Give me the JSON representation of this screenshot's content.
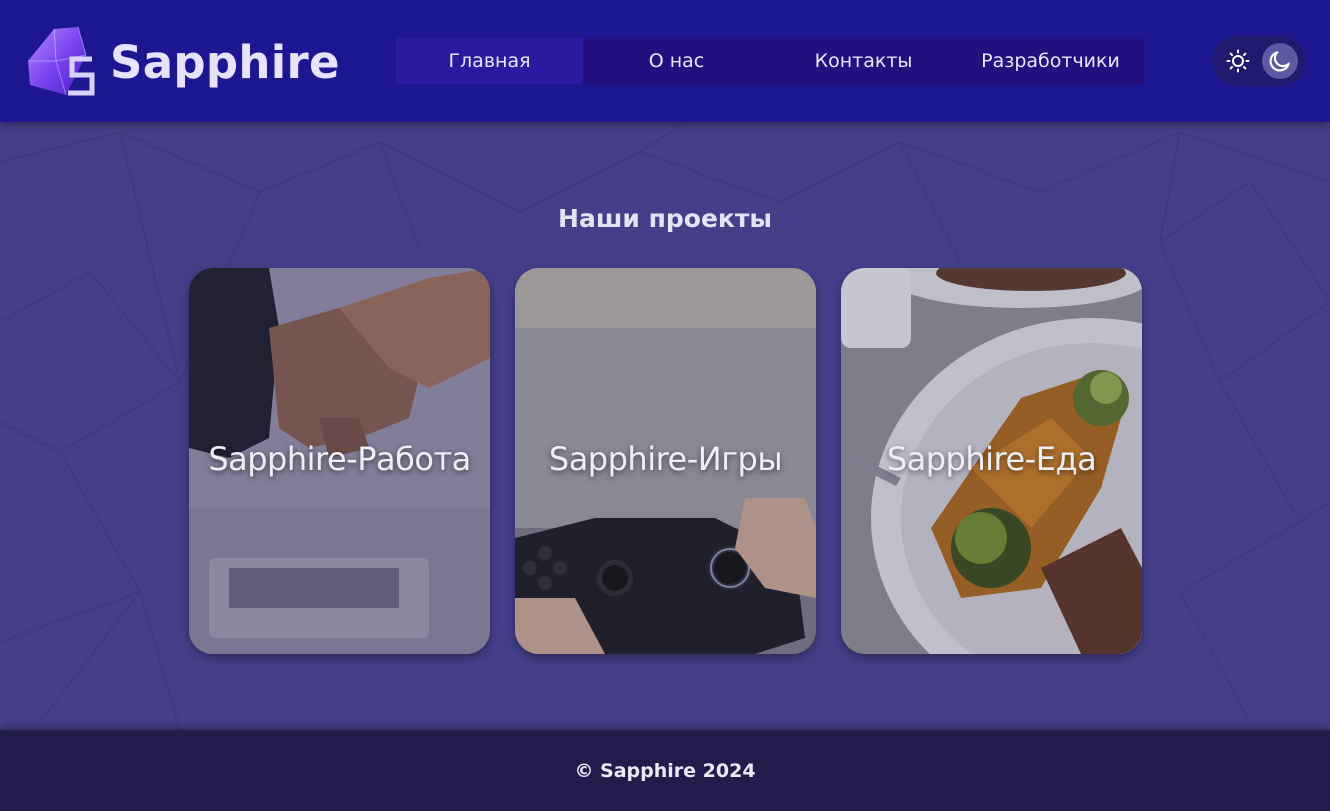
{
  "header": {
    "brand": "Sapphire",
    "nav": [
      {
        "label": "Главная",
        "active": true
      },
      {
        "label": "О нас",
        "active": false
      },
      {
        "label": "Контакты",
        "active": false
      },
      {
        "label": "Разработчики",
        "active": false
      }
    ],
    "theme_toggle": {
      "left_icon": "sun-icon",
      "right_icon": "moon-icon",
      "mode": "dark"
    }
  },
  "main": {
    "title": "Наши проекты",
    "projects": [
      {
        "label": "Sapphire-Работа",
        "image": "handshake"
      },
      {
        "label": "Sapphire-Игры",
        "image": "gamepad"
      },
      {
        "label": "Sapphire-Еда",
        "image": "food-plate"
      }
    ]
  },
  "footer": {
    "text": "© Sapphire 2024"
  },
  "colors": {
    "header_bg": "#1c1791",
    "nav_bg": "#230f7e",
    "nav_active_bg": "#2a1aa0",
    "page_bg": "#453f8a",
    "footer_bg": "#221c4c"
  }
}
